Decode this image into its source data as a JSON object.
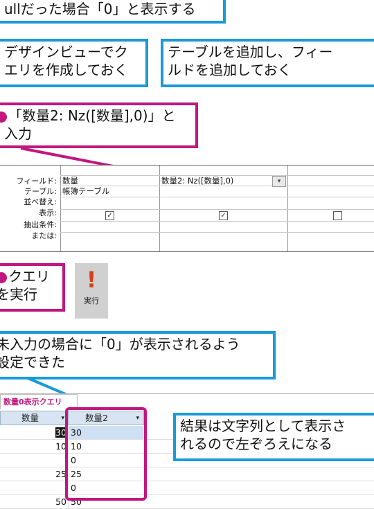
{
  "callouts": {
    "top": "ullだった場合「0」と表示する",
    "design_line1": "デザインビューでク",
    "design_line2": "エリを作成しておく",
    "addtable_line1": "テーブルを追加し、フィー",
    "addtable_line2": "ルドを追加しておく",
    "step2_line1": "「数量2: Nz([数量],0)」と",
    "step2_line2": "入力",
    "step3_line1": "クエリ",
    "step3_line2": "を実行",
    "result_line1": "未入力の場合に「0」が表示されるよう",
    "result_line2": "設定できた",
    "string_line1": "結果は文字列として表示さ",
    "string_line2": "れるので左ぞろえになる"
  },
  "query_grid": {
    "row_labels": [
      "フィールド:",
      "テーブル:",
      "並べ替え:",
      "表示:",
      "抽出条件:",
      "または:"
    ],
    "col1_field": "数量",
    "col1_table": "帳簿テーブル",
    "col2_field": "数量2: Nz([数量],0)",
    "col2_dropdown_icon": "chevron-down-icon",
    "show_checked": [
      true,
      true,
      false
    ]
  },
  "run_button": {
    "icon": "exclamation-icon",
    "label": "実行"
  },
  "datasheet": {
    "tab_label": "数量0表示クエリ",
    "col1_header": "数量",
    "col2_header": "数量2",
    "rows": [
      {
        "c1": "30",
        "c2": "30"
      },
      {
        "c1": "10",
        "c2": "10"
      },
      {
        "c1": "",
        "c2": "0"
      },
      {
        "c1": "25",
        "c2": "25"
      },
      {
        "c1": "",
        "c2": "0"
      },
      {
        "c1": "50",
        "c2": "50"
      }
    ]
  },
  "colors": {
    "blue_border": "#1a9ad6",
    "pink_border": "#c2177e",
    "selected_row": "#cfe0f4"
  }
}
